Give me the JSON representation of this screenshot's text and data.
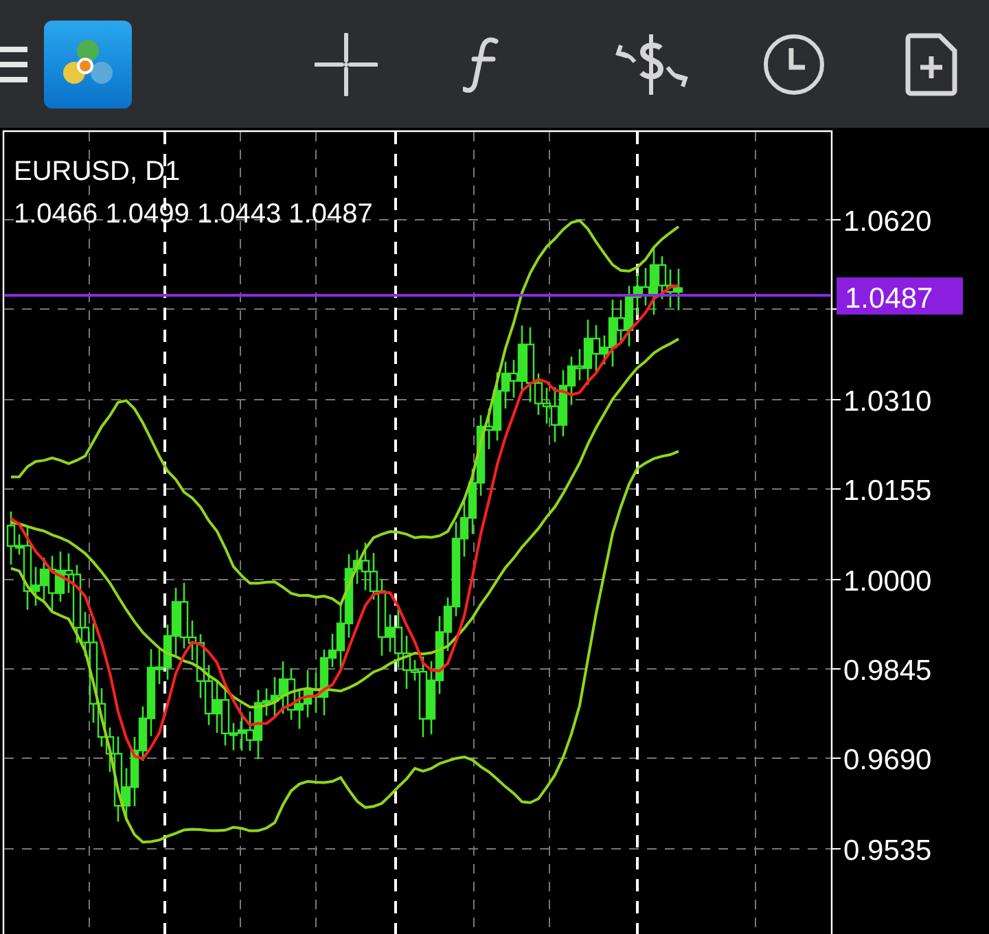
{
  "chart": {
    "symbol_timeframe": "EURUSD, D1",
    "ohlc": [
      "1.0466",
      "1.0499",
      "1.0443",
      "1.0487"
    ],
    "price_axis": [
      "1.0620",
      "1.0310",
      "1.0155",
      "1.0000",
      "0.9845",
      "0.9690",
      "0.9535"
    ],
    "current_price": "1.0487"
  }
}
